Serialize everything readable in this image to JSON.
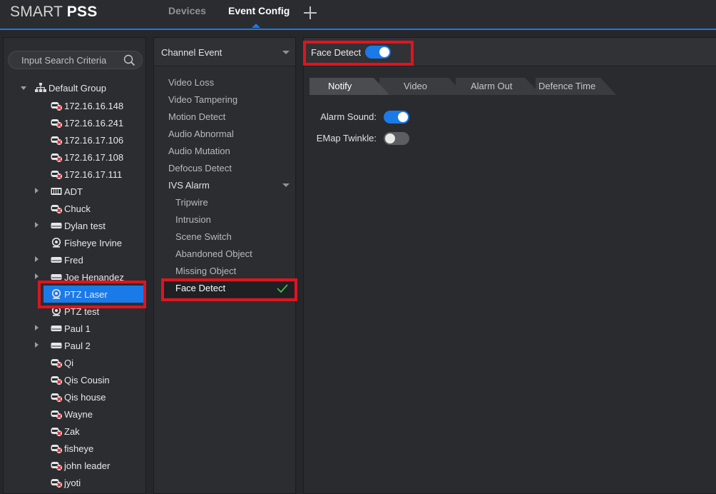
{
  "app": {
    "brand_light": "SMART ",
    "brand_bold": "PSS"
  },
  "nav": {
    "tabs": [
      "Devices",
      "Event Config"
    ],
    "active": "Event Config",
    "add_icon": "plus-icon"
  },
  "tree": {
    "search_placeholder": "Input Search Criteria",
    "root": "Default Group",
    "items": [
      {
        "label": "172.16.16.148",
        "icon": "nvr-offline-icon",
        "expandable": false
      },
      {
        "label": "172.16.16.241",
        "icon": "nvr-offline-icon",
        "expandable": false
      },
      {
        "label": "172.16.17.106",
        "icon": "nvr-offline-icon",
        "expandable": false
      },
      {
        "label": "172.16.17.108",
        "icon": "nvr-offline-icon",
        "expandable": false
      },
      {
        "label": "172.16.17.111",
        "icon": "nvr-offline-icon",
        "expandable": false
      },
      {
        "label": "ADT",
        "icon": "dvr-icon",
        "expandable": true
      },
      {
        "label": "Chuck",
        "icon": "nvr-offline-icon",
        "expandable": false
      },
      {
        "label": "Dylan test",
        "icon": "nvr-icon",
        "expandable": true
      },
      {
        "label": "Fisheye Irvine",
        "icon": "camera-icon",
        "expandable": false
      },
      {
        "label": "Fred",
        "icon": "nvr-icon",
        "expandable": true
      },
      {
        "label": "Joe Henandez",
        "icon": "nvr-icon",
        "expandable": true
      },
      {
        "label": "PTZ Laser",
        "icon": "camera-icon",
        "expandable": false,
        "selected": true
      },
      {
        "label": "PTZ test",
        "icon": "camera-icon",
        "expandable": false
      },
      {
        "label": "Paul 1",
        "icon": "nvr-icon",
        "expandable": true
      },
      {
        "label": "Paul 2",
        "icon": "nvr-icon",
        "expandable": true
      },
      {
        "label": "Qi",
        "icon": "nvr-offline-icon",
        "expandable": false
      },
      {
        "label": "Qis Cousin",
        "icon": "nvr-offline-icon",
        "expandable": false
      },
      {
        "label": "Qis house",
        "icon": "nvr-offline-icon",
        "expandable": false
      },
      {
        "label": "Wayne",
        "icon": "nvr-offline-icon",
        "expandable": false
      },
      {
        "label": "Zak",
        "icon": "nvr-offline-icon",
        "expandable": false
      },
      {
        "label": "fisheye",
        "icon": "nvr-offline-icon",
        "expandable": false
      },
      {
        "label": "john leader",
        "icon": "nvr-offline-icon",
        "expandable": false
      },
      {
        "label": "jyoti",
        "icon": "nvr-offline-icon",
        "expandable": false
      }
    ]
  },
  "events": {
    "header": "Channel Event",
    "items": [
      "Video Loss",
      "Video Tampering",
      "Motion Detect",
      "Audio Abnormal",
      "Audio Mutation",
      "Defocus Detect"
    ],
    "group": "IVS Alarm",
    "sub_items": [
      "Tripwire",
      "Intrusion",
      "Scene Switch",
      "Abandoned Object",
      "Missing Object",
      "Face Detect"
    ],
    "selected": "Face Detect"
  },
  "config": {
    "title": "Face Detect",
    "enabled": true,
    "tabs": [
      "Notify",
      "Video",
      "Alarm Out",
      "Defence Time"
    ],
    "active_tab": "Notify",
    "settings": [
      {
        "label": "Alarm Sound:",
        "on": true
      },
      {
        "label": "EMap Twinkle:",
        "on": false
      }
    ]
  },
  "colors": {
    "accent": "#1a7ae8",
    "highlight": "#e0141e",
    "check": "#3ec14a"
  }
}
